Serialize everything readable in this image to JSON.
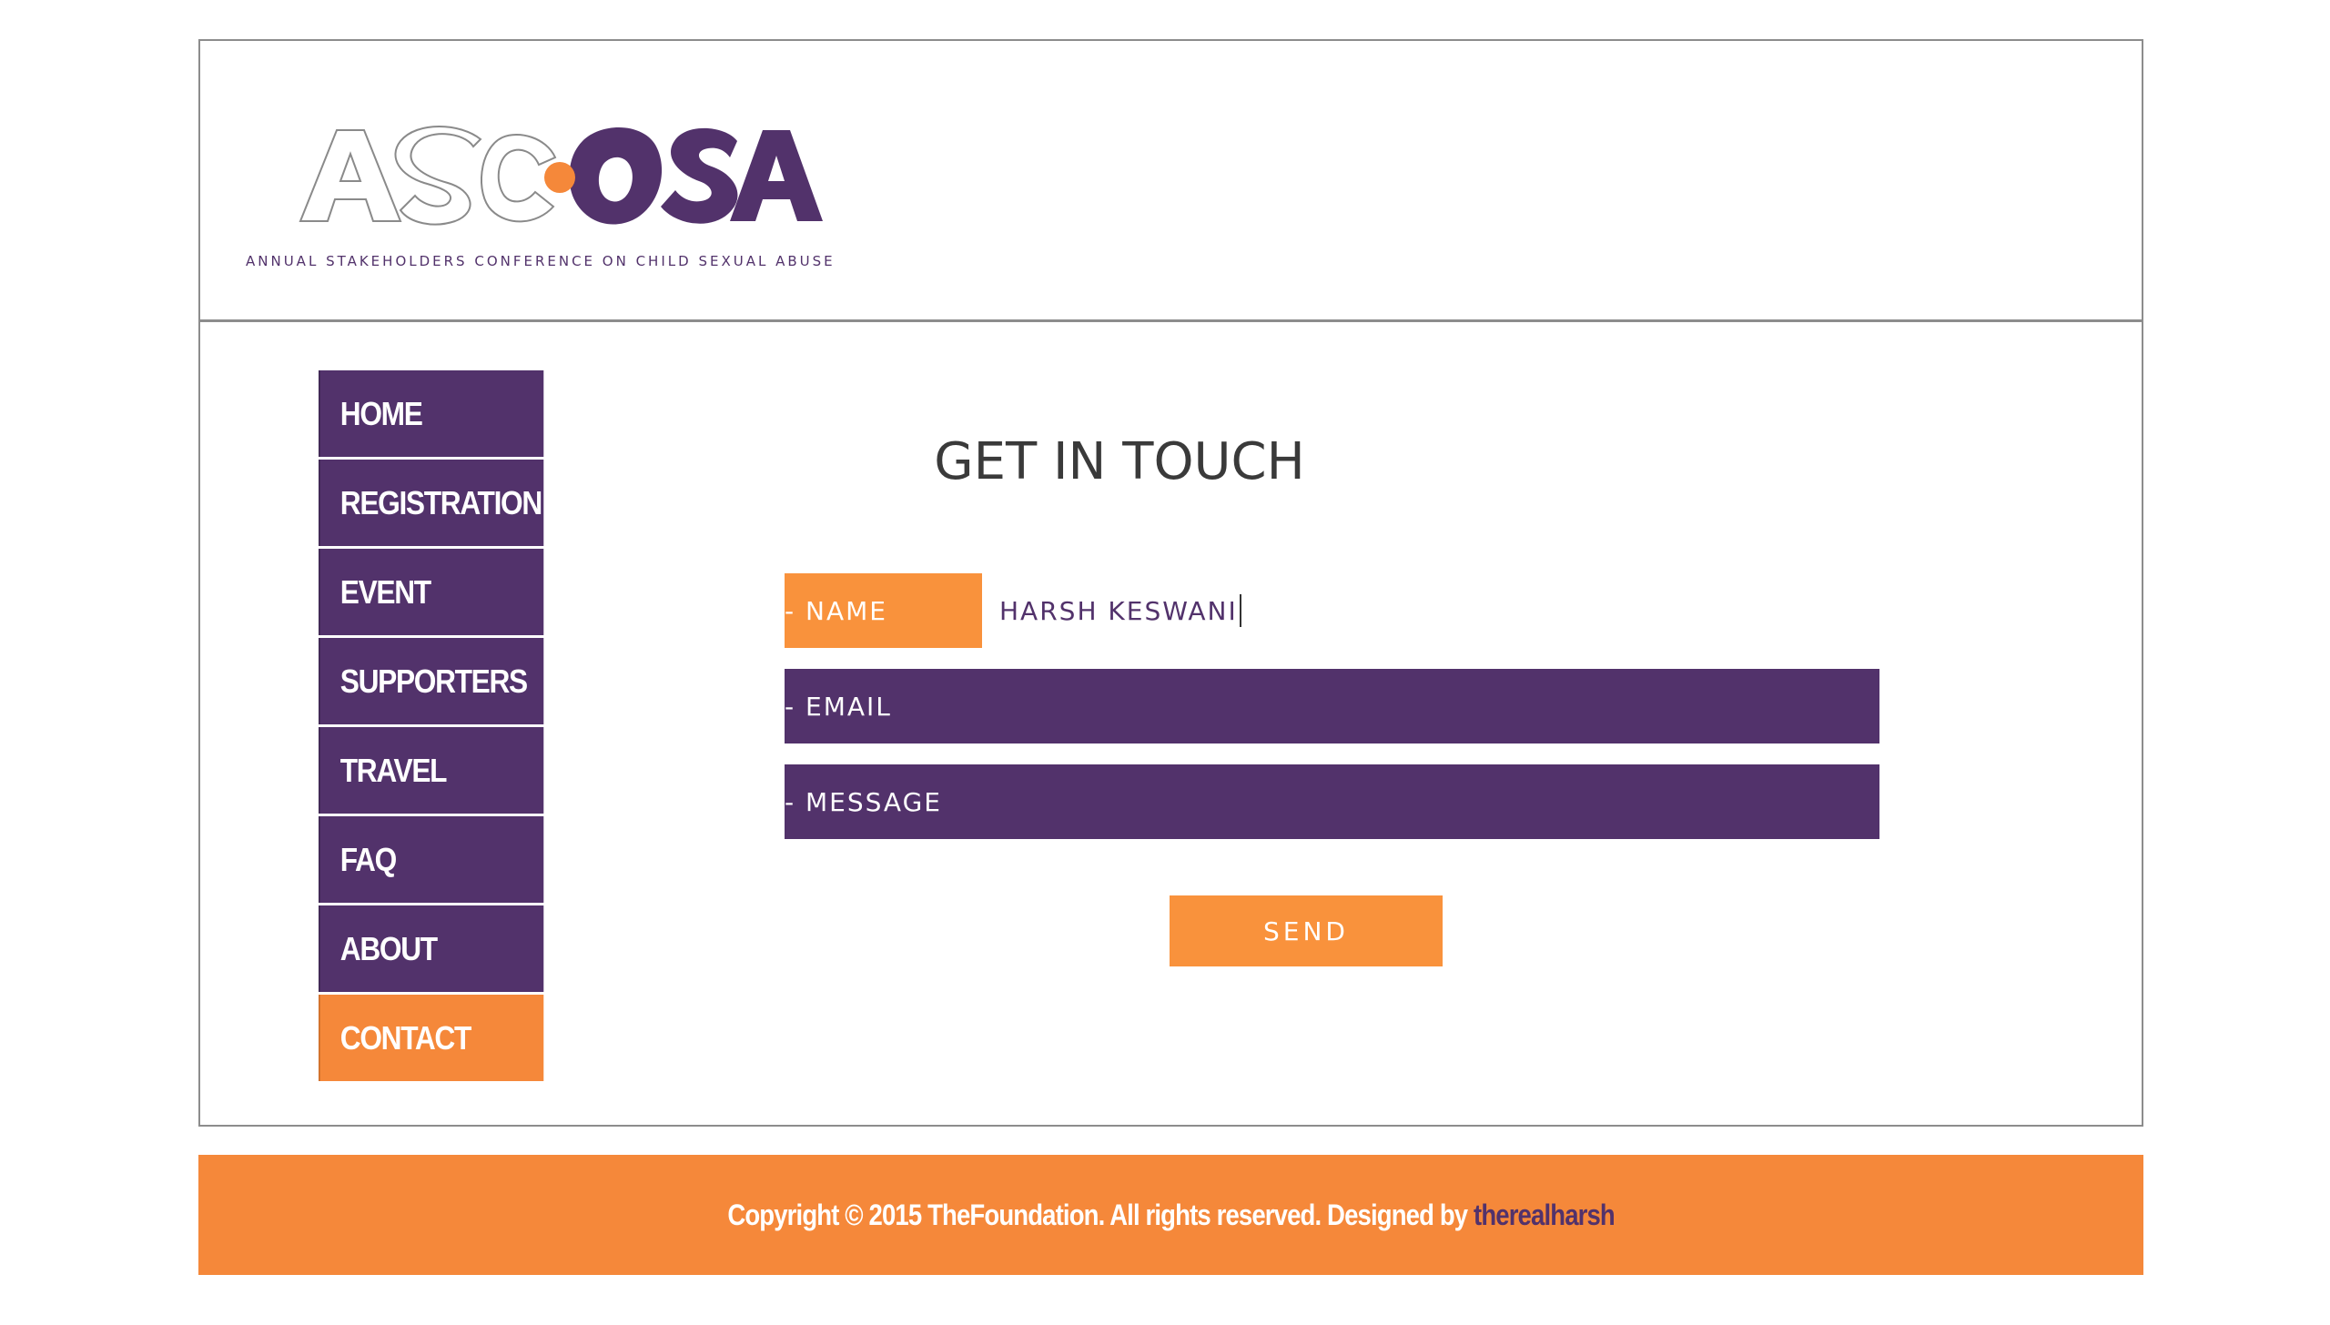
{
  "header": {
    "logo_text": "ASCOSA",
    "tagline": "ANNUAL STAKEHOLDERS CONFERENCE ON CHILD SEXUAL ABUSE",
    "colors": {
      "purple": "#52326b",
      "orange": "#f5883a"
    }
  },
  "nav": {
    "items": [
      {
        "label": "HOME",
        "active": false
      },
      {
        "label": "REGISTRATION",
        "active": false
      },
      {
        "label": "EVENT",
        "active": false
      },
      {
        "label": "SUPPORTERS",
        "active": false
      },
      {
        "label": "TRAVEL",
        "active": false
      },
      {
        "label": "FAQ",
        "active": false
      },
      {
        "label": "ABOUT",
        "active": false
      },
      {
        "label": "CONTACT",
        "active": true
      }
    ]
  },
  "contact": {
    "title": "GET IN TOUCH",
    "name_label": "- NAME",
    "name_value": "HARSH KESWANI",
    "email_label": "- EMAIL",
    "message_label": "- MESSAGE",
    "send_label": "SEND"
  },
  "footer": {
    "text": "Copyright © 2015 TheFoundation. All rights reserved. Designed by ",
    "link": "therealharsh"
  }
}
